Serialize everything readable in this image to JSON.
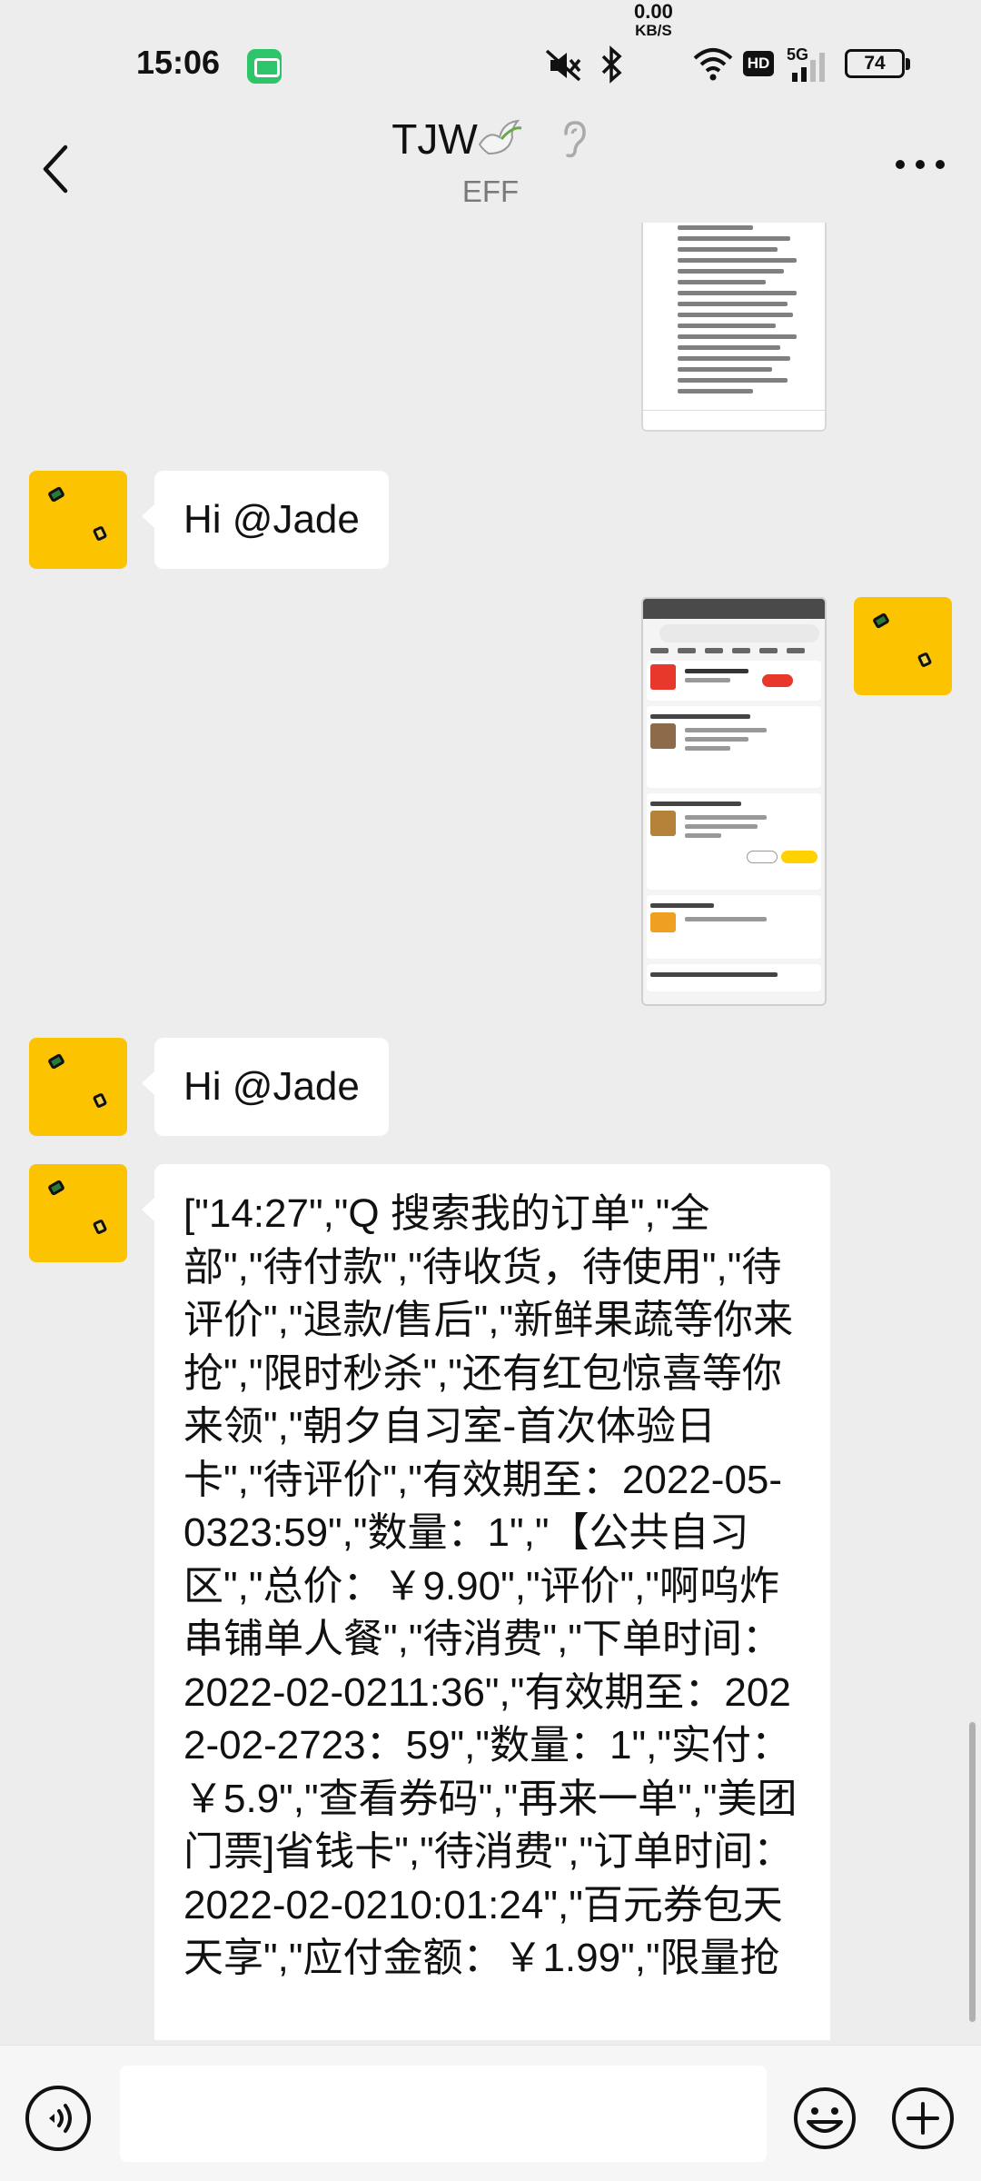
{
  "status_bar": {
    "time": "15:06",
    "net_speed_value": "0.00",
    "net_speed_unit": "KB/S",
    "network_type": "5G",
    "hd_label": "HD",
    "battery": "74",
    "icons": [
      "message-app-icon",
      "mute-icon",
      "bluetooth-icon",
      "wifi-icon",
      "signal-icon",
      "battery-icon"
    ]
  },
  "header": {
    "title": "TJW",
    "subtitle": "EFF",
    "icons": [
      "back-icon",
      "dove-emoji-icon",
      "ear-icon",
      "more-icon"
    ]
  },
  "messages": [
    {
      "type": "image",
      "from": "other",
      "description_icon": "document-image"
    },
    {
      "type": "text",
      "from": "other",
      "text": "Hi @Jade"
    },
    {
      "type": "image",
      "from": "me",
      "description_icon": "order-screenshot-image"
    },
    {
      "type": "text",
      "from": "other",
      "text": "Hi @Jade"
    },
    {
      "type": "text",
      "from": "other",
      "text": "[\"14:27\",\"Q 搜索我的订单\",\"全部\",\"待付款\",\"待收货，待使用\",\"待评价\",\"退款/售后\",\"新鲜果蔬等你来抢\",\"限时秒杀\",\"还有红包惊喜等你来领\",\"朝夕自习室-首次体验日卡\",\"待评价\",\"有效期至：2022-05-0323:59\",\"数量：1\",\"【公共自习区\",\"总价：￥9.90\",\"评价\",\"啊呜炸串铺单人餐\",\"待消费\",\"下单时间：2022-02-0211:36\",\"有效期至：2022-02-2723：59\",\"数量：1\",\"实付：￥5.9\",\"查看券码\",\"再来一单\",\"美团门票]省钱卡\",\"待消费\",\"订单时间：2022-02-0210:01:24\",\"百元券包天天享\",\"应付金额：￥1.99\",\"限量抢"
    }
  ],
  "input_bar": {
    "placeholder": "",
    "icons": [
      "voice-icon",
      "emoji-icon",
      "plus-icon"
    ]
  },
  "colors": {
    "background": "#ededed",
    "avatar": "#fbc300",
    "bubble": "#ffffff"
  }
}
